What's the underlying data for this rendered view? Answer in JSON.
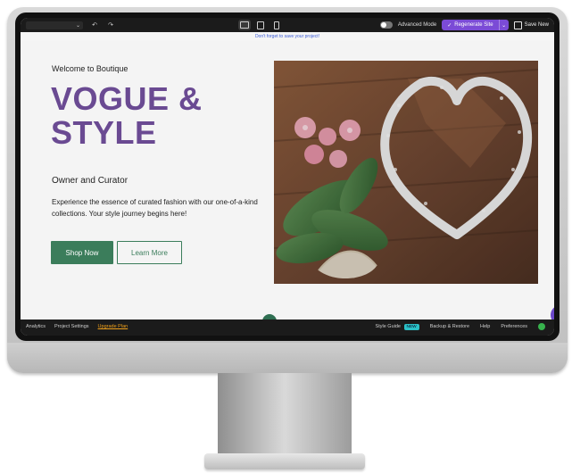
{
  "topbar": {
    "advanced_mode_label": "Advanced Mode",
    "regenerate_label": "Regenerate Site",
    "save_label": "Save New"
  },
  "notice": "Don't forget to save your project!",
  "hero": {
    "eyebrow": "Welcome to Boutique",
    "title_line1": "VOGUE &",
    "title_line2": "STYLE",
    "subtitle": "Owner and Curator",
    "description": "Experience the essence of curated fashion with our one-of-a-kind collections. Your style journey begins here!",
    "primary_cta": "Shop Now",
    "secondary_cta": "Learn More"
  },
  "bottombar": {
    "analytics": "Analytics",
    "project_settings": "Project Settings",
    "upgrade_plan": "Upgrade Plan",
    "style_guide": "Style Guide",
    "style_guide_badge": "NEW",
    "backup_restore": "Backup & Restore",
    "help": "Help",
    "preferences": "Preferences"
  },
  "colors": {
    "accent_purple": "#6a4a92",
    "button_green": "#3b7d5b",
    "regen_purple": "#7b4bd6"
  },
  "icons": {
    "undo": "undo-icon",
    "redo": "redo-icon",
    "desktop": "desktop-icon",
    "tablet": "tablet-icon",
    "mobile": "mobile-icon",
    "chat": "chat-icon",
    "chevron_down": "chevron-down-icon"
  }
}
